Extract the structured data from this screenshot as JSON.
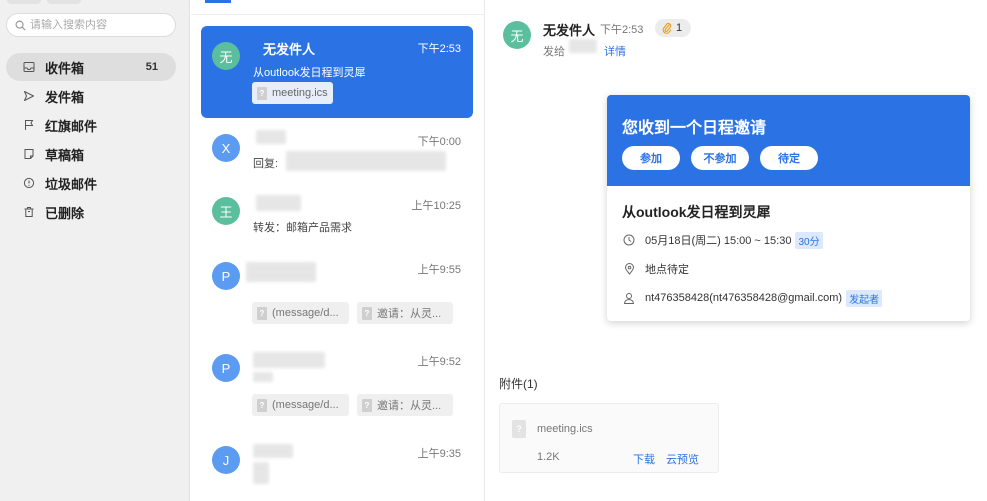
{
  "search": {
    "placeholder": "请输入搜索内容"
  },
  "folders": [
    {
      "label": "收件箱",
      "count": "51",
      "icon": "inbox-icon"
    },
    {
      "label": "发件箱",
      "icon": "send-icon"
    },
    {
      "label": "红旗邮件",
      "icon": "flag-icon"
    },
    {
      "label": "草稿箱",
      "icon": "draft-icon"
    },
    {
      "label": "垃圾邮件",
      "icon": "spam-icon"
    },
    {
      "label": "已删除",
      "icon": "trash-icon"
    }
  ],
  "mails": [
    {
      "avatar": "无",
      "avatar_color": "#5bbf9d",
      "sender": "无发件人",
      "time": "下午2:53",
      "subject": "从outlook发日程到灵犀",
      "attachments": [
        "meeting.ics"
      ]
    },
    {
      "avatar": "X",
      "avatar_color": "#5b9cf2",
      "sender": "",
      "time": "下午0:00",
      "subject": "回复:",
      "attachments": []
    },
    {
      "avatar": "王",
      "avatar_color": "#5bbf9d",
      "sender": "",
      "time": "上午10:25",
      "subject": "转发：邮箱产品需求",
      "attachments": []
    },
    {
      "avatar": "P",
      "avatar_color": "#5b9cf2",
      "sender": "",
      "time": "上午9:55",
      "subject": "",
      "attachments": [
        "(message/d...",
        "邀请：从灵..."
      ]
    },
    {
      "avatar": "P",
      "avatar_color": "#5b9cf2",
      "sender": "",
      "time": "上午9:52",
      "subject": "",
      "attachments": [
        "(message/d...",
        "邀请：从灵..."
      ]
    },
    {
      "avatar": "J",
      "avatar_color": "#5b9cf2",
      "sender": "",
      "time": "上午9:35",
      "subject": "",
      "attachments": []
    }
  ],
  "reader": {
    "avatar": "无",
    "sender": "无发件人",
    "time": "下午2:53",
    "attachment_count": "1",
    "to_label": "发给",
    "details_label": "详情",
    "invite": {
      "title": "您收到一个日程邀请",
      "buttons": [
        "参加",
        "不参加",
        "待定"
      ],
      "subject": "从outlook发日程到灵犀",
      "datetime": "05月18日(周二) 15:00 ~ 15:30",
      "duration": "30分",
      "location": "地点待定",
      "organizer": "nt476358428(nt476358428@gmail.com)",
      "organizer_tag": "发起者"
    },
    "attachments_title": "附件(1)",
    "attachment": {
      "name": "meeting.ics",
      "size": "1.2K",
      "download": "下载",
      "preview": "云预览"
    }
  },
  "colors": {
    "accent": "#2b73e4",
    "green_avatar": "#5bbf9d",
    "blue_avatar": "#5b9cf2"
  }
}
